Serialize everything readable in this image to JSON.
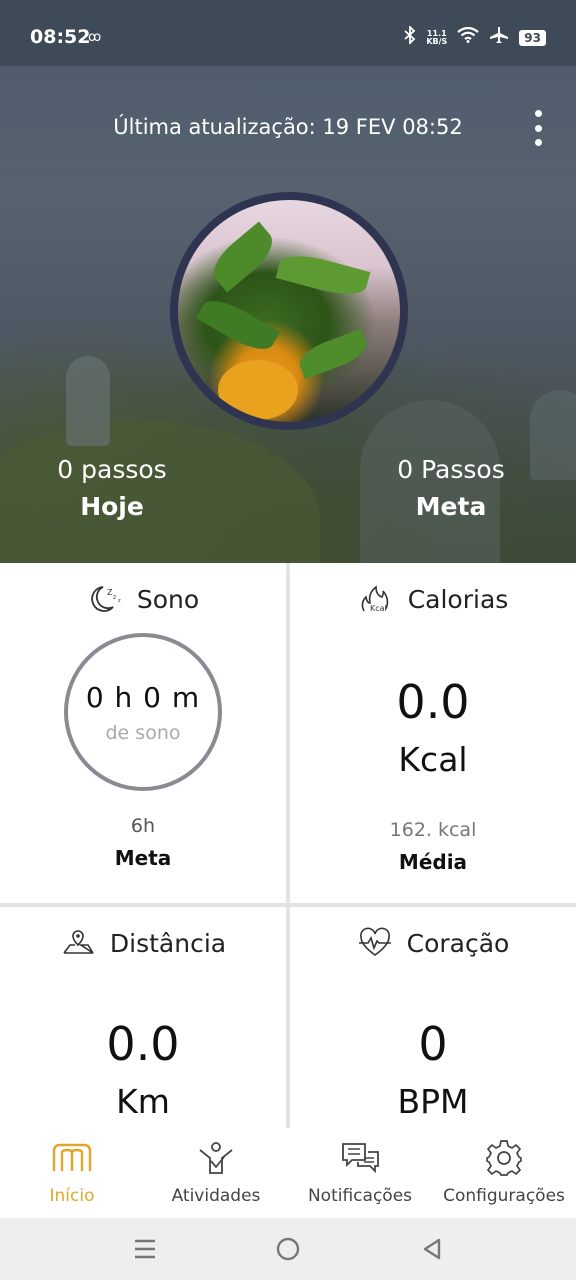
{
  "status_bar": {
    "time": "08:52",
    "net_speed_value": "11.1",
    "net_speed_unit": "KB/S",
    "battery": "93"
  },
  "header": {
    "last_update": "Última atualização: 19 FEV 08:52",
    "steps_today_value": "0 passos",
    "steps_today_label": "Hoje",
    "steps_goal_value": "0 Passos",
    "steps_goal_label": "Meta"
  },
  "cards": {
    "sleep": {
      "title": "Sono",
      "value": "0 h 0 m",
      "sub": "de sono",
      "goal_value": "6h",
      "goal_label": "Meta"
    },
    "calories": {
      "title": "Calorias",
      "value": "0.0",
      "unit": "Kcal",
      "avg_value": "162. kcal",
      "avg_label": "Média"
    },
    "distance": {
      "title": "Distância",
      "value": "0.0",
      "unit": "Km"
    },
    "heart": {
      "title": "Coração",
      "value": "0",
      "unit": "BPM"
    }
  },
  "bottom_nav": {
    "items": [
      {
        "label": "Início",
        "icon": "home-m-icon",
        "active": true
      },
      {
        "label": "Atividades",
        "icon": "activity-person-icon",
        "active": false
      },
      {
        "label": "Notificações",
        "icon": "chat-bubbles-icon",
        "active": false
      },
      {
        "label": "Configurações",
        "icon": "gear-icon",
        "active": false
      }
    ]
  },
  "colors": {
    "accent": "#e2a62a",
    "status_bar_bg": "#3f4a59",
    "avatar_border": "#2f3450",
    "ring": "#8a8a93"
  }
}
